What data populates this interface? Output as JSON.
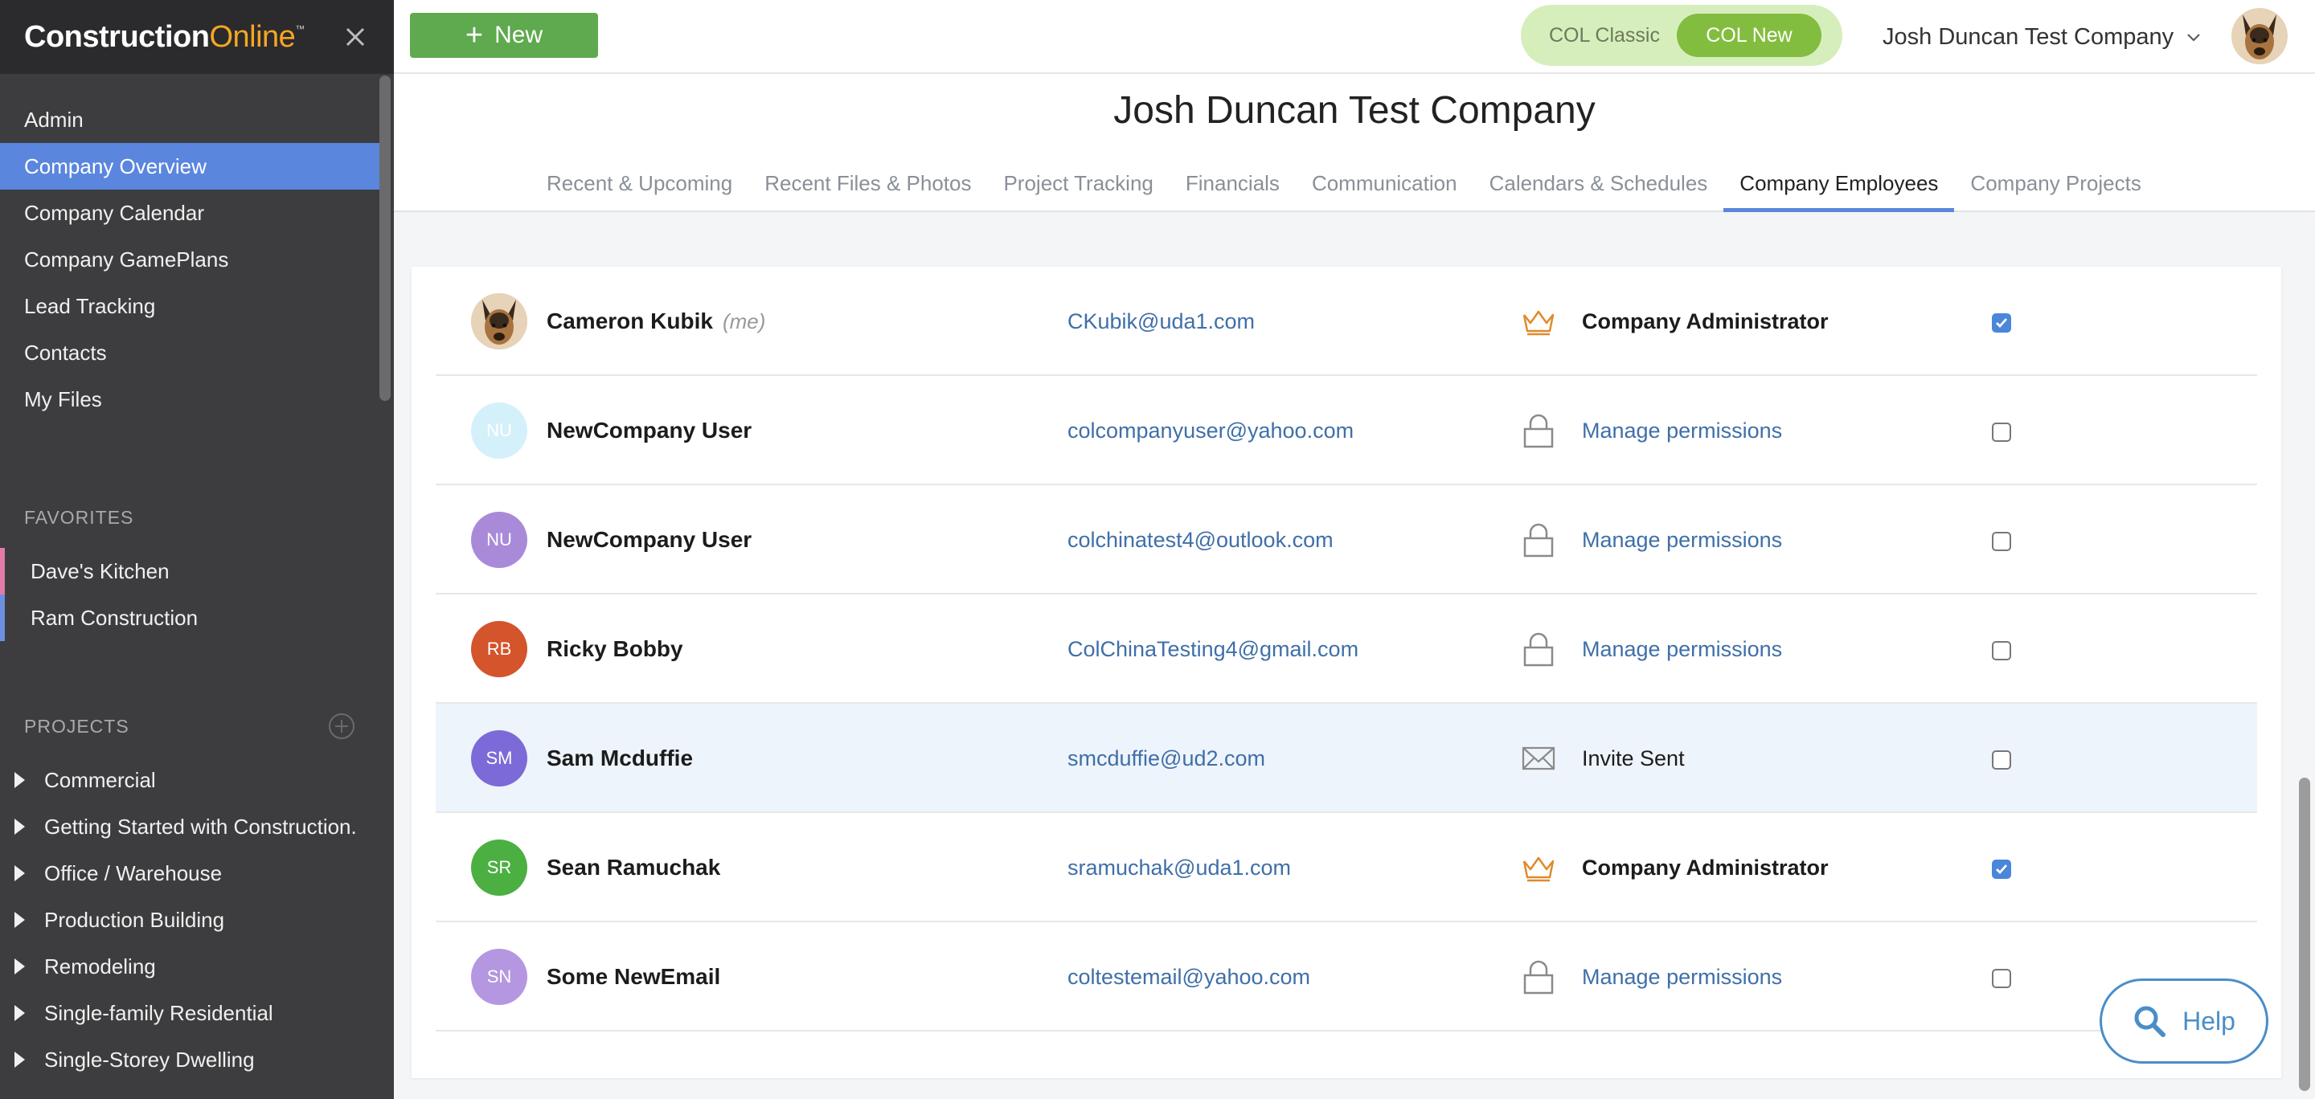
{
  "brand": {
    "name_main": "Construction",
    "name_accent": "Online",
    "tm": "™"
  },
  "sidebar": {
    "nav": [
      {
        "label": "Admin",
        "active": false
      },
      {
        "label": "Company Overview",
        "active": true
      },
      {
        "label": "Company Calendar",
        "active": false
      },
      {
        "label": "Company GamePlans",
        "active": false
      },
      {
        "label": "Lead Tracking",
        "active": false
      },
      {
        "label": "Contacts",
        "active": false
      },
      {
        "label": "My Files",
        "active": false
      }
    ],
    "favorites_title": "FAVORITES",
    "favorites": [
      {
        "label": "Dave's Kitchen",
        "color": "#e27ba8"
      },
      {
        "label": "Ram Construction",
        "color": "#6c8fe0"
      }
    ],
    "projects_title": "PROJECTS",
    "projects": [
      {
        "label": "Commercial"
      },
      {
        "label": "Getting Started with Construction."
      },
      {
        "label": "Office / Warehouse"
      },
      {
        "label": "Production Building"
      },
      {
        "label": "Remodeling"
      },
      {
        "label": "Single-family Residential"
      },
      {
        "label": "Single-Storey Dwelling"
      }
    ]
  },
  "topbar": {
    "new_label": "New",
    "toggle": {
      "classic": "COL Classic",
      "new": "COL New",
      "selected": "COL New"
    },
    "company": "Josh Duncan Test Company"
  },
  "page": {
    "title": "Josh Duncan Test Company",
    "tabs": [
      {
        "label": "Recent & Upcoming",
        "active": false
      },
      {
        "label": "Recent Files & Photos",
        "active": false
      },
      {
        "label": "Project Tracking",
        "active": false
      },
      {
        "label": "Financials",
        "active": false
      },
      {
        "label": "Communication",
        "active": false
      },
      {
        "label": "Calendars & Schedules",
        "active": false
      },
      {
        "label": "Company Employees",
        "active": true
      },
      {
        "label": "Company Projects",
        "active": false
      }
    ]
  },
  "employees": [
    {
      "name": "Cameron Kubik",
      "me_tag": "(me)",
      "initials": "",
      "avatar_color": "#e9d8c0",
      "photo": true,
      "email": "CKubik@uda1.com",
      "role_type": "admin",
      "role_label": "Company Administrator",
      "checked": true,
      "highlight": false
    },
    {
      "name": "NewCompany User",
      "me_tag": "",
      "initials": "NU",
      "avatar_color": "#d4f0fb",
      "photo": false,
      "email": "colcompanyuser@yahoo.com",
      "role_type": "manage",
      "role_label": "Manage permissions",
      "checked": false,
      "highlight": false
    },
    {
      "name": "NewCompany User",
      "me_tag": "",
      "initials": "NU",
      "avatar_color": "#a98ad8",
      "photo": false,
      "email": "colchinatest4@outlook.com",
      "role_type": "manage",
      "role_label": "Manage permissions",
      "checked": false,
      "highlight": false
    },
    {
      "name": "Ricky Bobby",
      "me_tag": "",
      "initials": "RB",
      "avatar_color": "#d4542b",
      "photo": false,
      "email": "ColChinaTesting4@gmail.com",
      "role_type": "manage",
      "role_label": "Manage permissions",
      "checked": false,
      "highlight": false
    },
    {
      "name": "Sam Mcduffie",
      "me_tag": "",
      "initials": "SM",
      "avatar_color": "#7b6ad8",
      "photo": false,
      "email": "smcduffie@ud2.com",
      "role_type": "invite",
      "role_label": "Invite Sent",
      "checked": false,
      "highlight": true
    },
    {
      "name": "Sean Ramuchak",
      "me_tag": "",
      "initials": "SR",
      "avatar_color": "#4caf42",
      "photo": false,
      "email": "sramuchak@uda1.com",
      "role_type": "admin",
      "role_label": "Company Administrator",
      "checked": true,
      "highlight": false
    },
    {
      "name": "Some NewEmail",
      "me_tag": "",
      "initials": "SN",
      "avatar_color": "#b497e0",
      "photo": false,
      "email": "coltestemail@yahoo.com",
      "role_type": "manage",
      "role_label": "Manage permissions",
      "checked": false,
      "highlight": false
    }
  ],
  "help_label": "Help",
  "colors": {
    "accent": "#5b86de",
    "brand_orange": "#f6a623",
    "new_green": "#5fa94e",
    "link": "#3f6fa8"
  },
  "icons": {
    "close": "close-icon",
    "plus": "plus-icon",
    "chevron": "chevron-down-icon",
    "crown": "crown-icon",
    "lock": "lock-icon",
    "envelope": "envelope-icon",
    "search": "search-icon",
    "add_project": "add-circle-icon"
  }
}
